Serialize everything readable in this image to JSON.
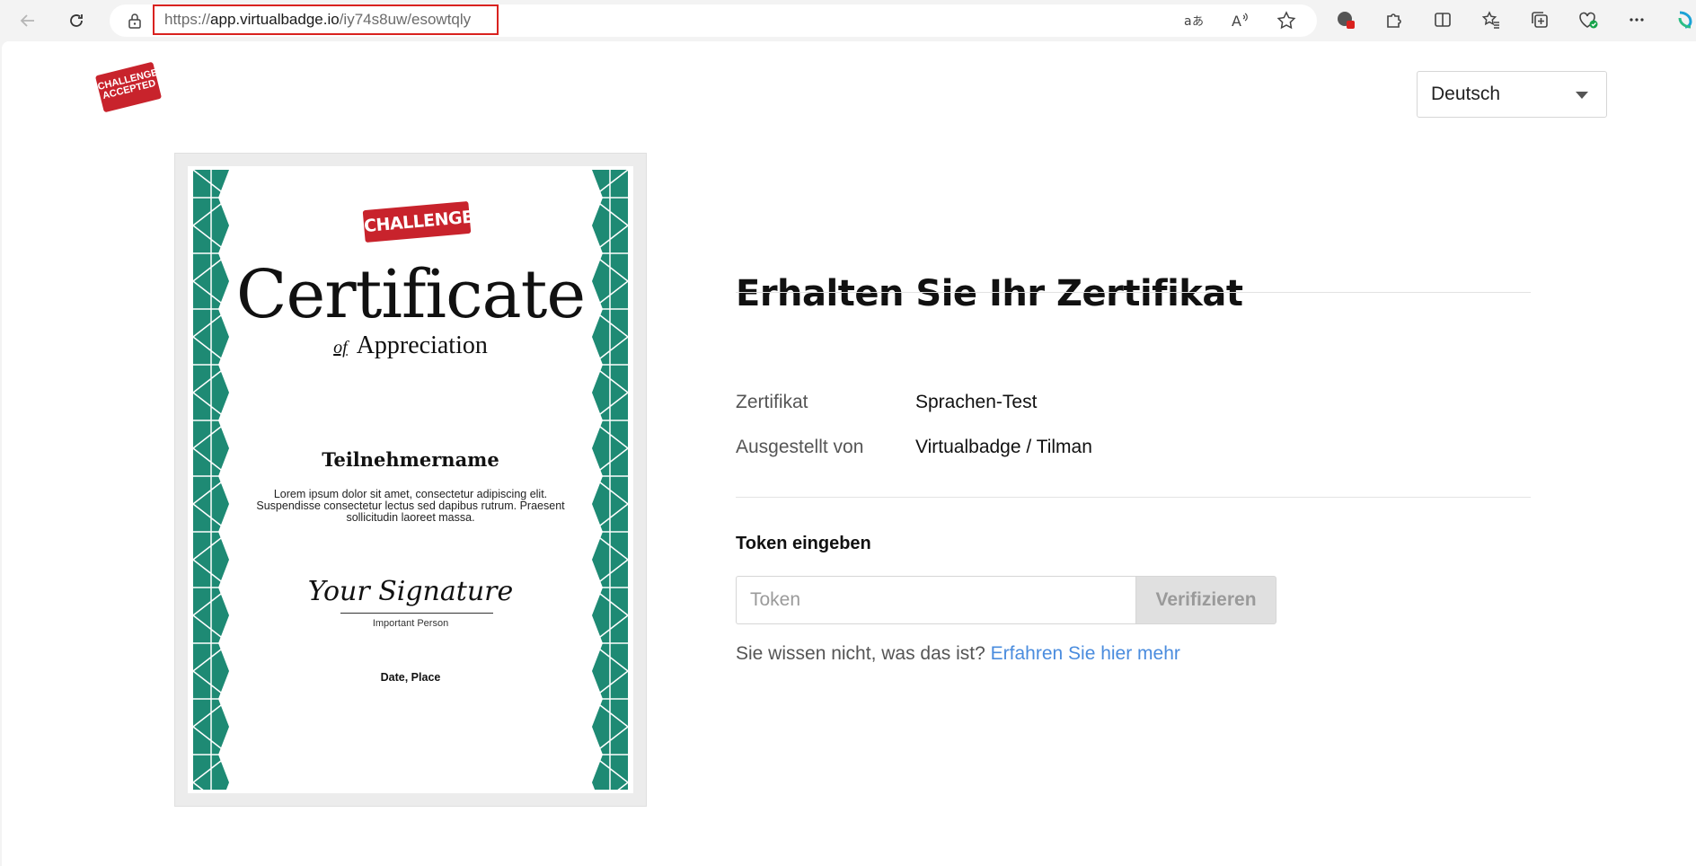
{
  "browser": {
    "url_protocol": "https://",
    "url_host": "app.virtualbadge.io",
    "url_path": "/iy74s8uw/esowtqly"
  },
  "header": {
    "logo_text": "CHALLENGE ACCEPTED",
    "language": "Deutsch"
  },
  "certificate": {
    "logo_text": "CHALLENGE ACCEPTED",
    "title": "Certificate",
    "subtitle_of": "of",
    "subtitle": "Appreciation",
    "participant": "Teilnehmername",
    "lorem": "Lorem ipsum dolor sit amet, consectetur adipiscing elit. Suspendisse consectetur lectus sed dapibus rutrum. Praesent sollicitudin laoreet massa.",
    "signature": "Your Signature",
    "person": "Important Person",
    "date_place": "Date, Place",
    "border_color": "#1e8a74"
  },
  "main": {
    "heading": "Erhalten Sie Ihr Zertifikat",
    "info": [
      {
        "label": "Zertifikat",
        "value": "Sprachen-Test"
      },
      {
        "label": "Ausgestellt von",
        "value": "Virtualbadge / Tilman"
      }
    ],
    "token_heading": "Token eingeben",
    "token_placeholder": "Token",
    "verify_label": "Verifizieren",
    "help_prefix": "Sie wissen nicht, was das ist?",
    "help_link": "Erfahren Sie hier mehr"
  }
}
